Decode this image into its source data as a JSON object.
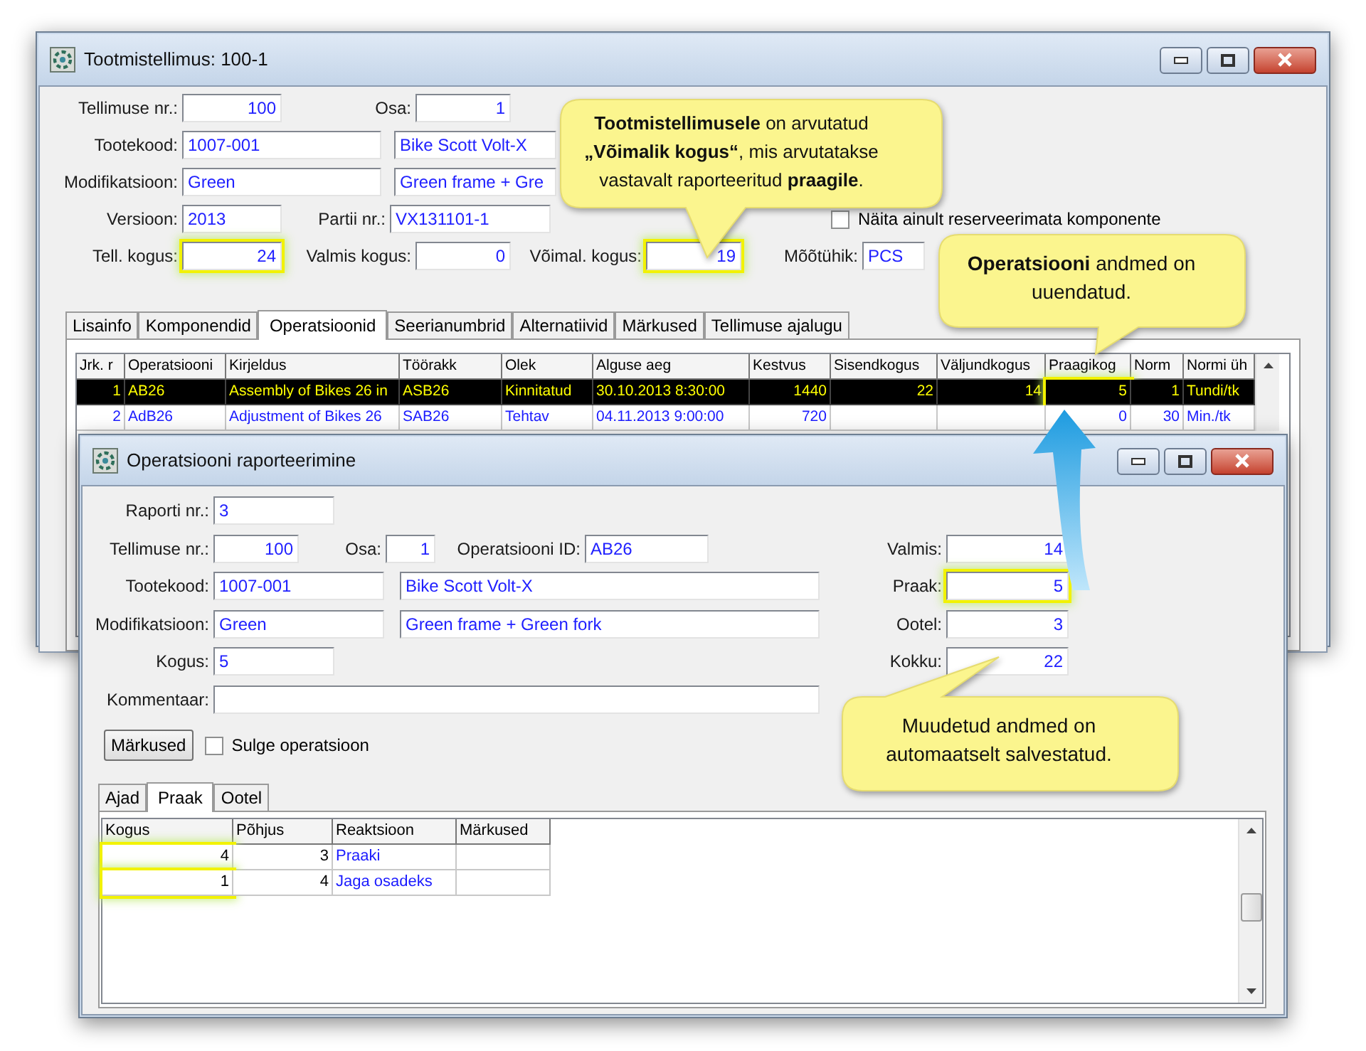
{
  "main_window": {
    "title": "Tootmistellimus: 100-1",
    "rows": [
      [
        {
          "kind": "field",
          "label": "Tellimuse nr.:",
          "value": "100",
          "highlighted": false
        },
        {
          "kind": "field",
          "label": "Osa:",
          "value": "1",
          "highlighted": false
        }
      ],
      [
        {
          "kind": "field",
          "label": "Tootekood:",
          "value": "1007-001",
          "highlighted": false
        },
        {
          "kind": "field",
          "value": "Bike Scott Volt-X",
          "highlighted": false
        }
      ],
      [
        {
          "kind": "field",
          "label": "Modifikatsioon:",
          "value": "Green",
          "highlighted": false
        },
        {
          "kind": "field",
          "value": "Green frame + Gre",
          "highlighted": false
        }
      ],
      [
        {
          "kind": "field",
          "label": "Versioon:",
          "value": "2013",
          "highlighted": false
        },
        {
          "kind": "field",
          "label": "Partii nr.:",
          "value": "VX131101-1",
          "highlighted": false
        },
        {
          "kind": "checkbox",
          "label": "Näita ainult reserveerimata komponente",
          "checked": false
        }
      ],
      [
        {
          "kind": "field",
          "label": "Tell. kogus:",
          "value": "24",
          "highlighted": true
        },
        {
          "kind": "field",
          "label": "Valmis kogus:",
          "value": "0",
          "highlighted": false
        },
        {
          "kind": "field",
          "label": "Võimal. kogus:",
          "value": "19",
          "highlighted": true
        },
        {
          "kind": "field",
          "label": "Mõõtühik:",
          "value": "PCS",
          "highlighted": false
        }
      ]
    ],
    "tabs": [
      {
        "label": "Lisainfo",
        "selected": false
      },
      {
        "label": "Komponendid",
        "selected": false
      },
      {
        "label": "Operatsioonid",
        "selected": true
      },
      {
        "label": "Seerianumbrid",
        "selected": false
      },
      {
        "label": "Alternatiivid",
        "selected": false
      },
      {
        "label": "Märkused",
        "selected": false
      },
      {
        "label": "Tellimuse ajalugu",
        "selected": false
      }
    ],
    "table": {
      "columns": [
        "Jrk. r",
        "Operatsiooni",
        "Kirjeldus",
        "Töörakk",
        "Olek",
        "Alguse aeg",
        "Kestvus",
        "Sisendkogus",
        "Väljundkogus",
        "Praagikog",
        "Norm",
        "Normi üh"
      ],
      "rows": [
        {
          "selected": true,
          "cells": [
            {
              "text": "1",
              "highlighted": false
            },
            {
              "text": "AB26",
              "highlighted": false
            },
            {
              "text": "Assembly of Bikes 26 in",
              "highlighted": false
            },
            {
              "text": "ASB26",
              "highlighted": false
            },
            {
              "text": "Kinnitatud",
              "highlighted": false
            },
            {
              "text": "30.10.2013 8:30:00",
              "highlighted": false
            },
            {
              "text": "1440",
              "highlighted": false
            },
            {
              "text": "22",
              "highlighted": false
            },
            {
              "text": "14",
              "highlighted": false
            },
            {
              "text": "5",
              "highlighted": true
            },
            {
              "text": "1",
              "highlighted": false
            },
            {
              "text": "Tundi/tk",
              "highlighted": false
            }
          ]
        },
        {
          "selected": false,
          "cells": [
            {
              "text": "2",
              "highlighted": false
            },
            {
              "text": "AdB26",
              "highlighted": false
            },
            {
              "text": "Adjustment of Bikes 26",
              "highlighted": false
            },
            {
              "text": "SAB26",
              "highlighted": false
            },
            {
              "text": "Tehtav",
              "highlighted": false
            },
            {
              "text": "04.11.2013 9:00:00",
              "highlighted": false
            },
            {
              "text": "720",
              "highlighted": false
            },
            {
              "highlighted": false
            },
            {
              "highlighted": false
            },
            {
              "text": "0",
              "highlighted": false
            },
            {
              "text": "30",
              "highlighted": false
            },
            {
              "text": "Min./tk",
              "highlighted": false
            }
          ]
        }
      ]
    }
  },
  "report_window": {
    "title": "Operatsiooni raporteerimine",
    "rows": [
      [
        {
          "kind": "field",
          "label": "Raporti nr.:",
          "value": "3",
          "highlighted": false
        }
      ],
      [
        {
          "kind": "field",
          "label": "Tellimuse nr.:",
          "value": "100",
          "highlighted": false
        },
        {
          "kind": "field",
          "label": "Osa:",
          "value": "1",
          "highlighted": false
        },
        {
          "kind": "field",
          "label": "Operatsiooni ID:",
          "value": "AB26",
          "highlighted": false
        }
      ],
      [
        {
          "kind": "field",
          "label": "Tootekood:",
          "value": "1007-001",
          "highlighted": false
        },
        {
          "kind": "field",
          "value": "Bike Scott Volt-X",
          "highlighted": false
        }
      ],
      [
        {
          "kind": "field",
          "label": "Modifikatsioon:",
          "value": "Green",
          "highlighted": false
        },
        {
          "kind": "field",
          "value": "Green frame + Green fork",
          "highlighted": false
        }
      ],
      [
        {
          "kind": "field",
          "label": "Kogus:",
          "value": "5",
          "highlighted": false
        }
      ],
      [
        {
          "kind": "field",
          "label": "Kommentaar:",
          "highlighted": false
        }
      ]
    ],
    "quantities": [
      {
        "kind": "field",
        "label": "Valmis:",
        "value": "14",
        "highlighted": false
      },
      {
        "kind": "field",
        "label": "Praak:",
        "value": "5",
        "highlighted": true
      },
      {
        "kind": "field",
        "label": "Ootel:",
        "value": "3",
        "highlighted": false
      },
      {
        "kind": "field",
        "label": "Kokku:",
        "value": "22",
        "highlighted": false
      }
    ],
    "button": "Märkused",
    "checkbox": {
      "label": "Sulge operatsioon",
      "checked": false
    },
    "tabs": [
      {
        "label": "Ajad",
        "selected": false
      },
      {
        "label": "Praak",
        "selected": true
      },
      {
        "label": "Ootel",
        "selected": false
      }
    ],
    "table": {
      "columns": [
        "Kogus",
        "Põhjus",
        "Reaktsioon",
        "Märkused"
      ],
      "rows": [
        {
          "cells": [
            {
              "text": "4",
              "highlighted": true
            },
            {
              "text": "3",
              "highlighted": false
            },
            {
              "text": "Praaki",
              "highlighted": false
            },
            {
              "highlighted": false
            }
          ]
        },
        {
          "cells": [
            {
              "text": "1",
              "highlighted": true
            },
            {
              "text": "4",
              "highlighted": false
            },
            {
              "text": "Jaga osadeks",
              "highlighted": false
            },
            {
              "highlighted": false
            }
          ]
        }
      ]
    }
  },
  "callouts": [
    {
      "text": "**Tootmistellimusele** on arvutatud **„Võimalik kogus“**, mis arvutatakse vastavalt raporteeritud **praagile**."
    },
    {
      "text": "**Operatsiooni** andmed on uuendatud."
    },
    {
      "text": "Muudetud andmed on automaatselt salvestatud."
    }
  ]
}
